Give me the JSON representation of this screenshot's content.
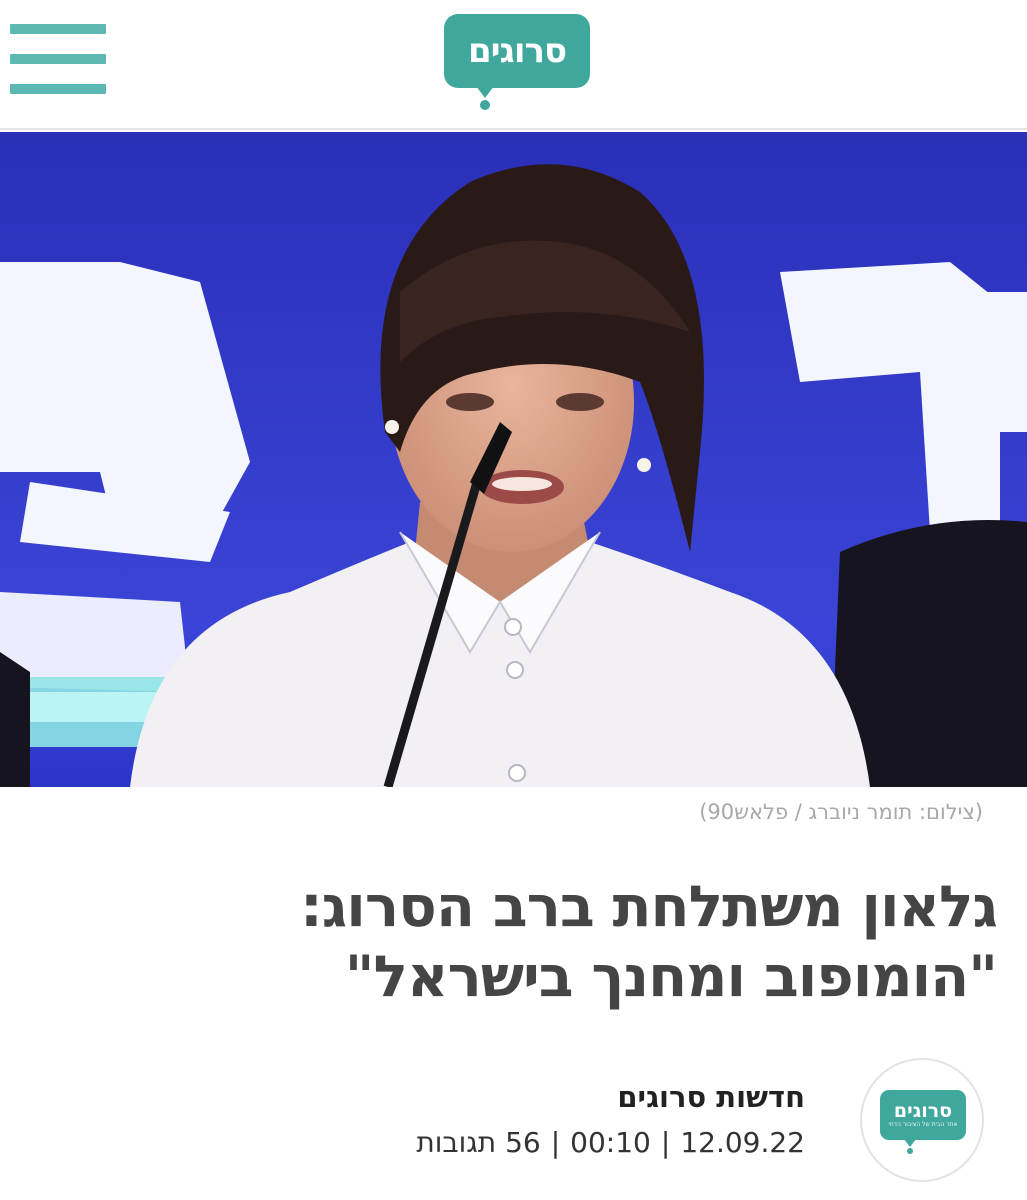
{
  "header": {
    "logo_text": "סרוגים",
    "menu_icon": "hamburger-menu-icon"
  },
  "colors": {
    "brand_teal": "#3fa79c",
    "menu_teal": "#5cb8b2",
    "hero_backdrop_blue": "#2b35c8"
  },
  "article": {
    "image_caption": "(צילום: תומר ניוברג / פלאש90)",
    "headline_line1": "גלאון משתלחת ברב הסרוג:",
    "headline_line2": "\"הומופוב ומחנך בישראל\"",
    "author": {
      "name": "חדשות סרוגים",
      "avatar_logo_text": "סרוגים",
      "avatar_tagline": "אתר הבית של הציבור הדתי"
    },
    "meta": {
      "date": "12.09.22",
      "time": "00:10",
      "comments": "56 תגובות",
      "separator": "|"
    }
  }
}
